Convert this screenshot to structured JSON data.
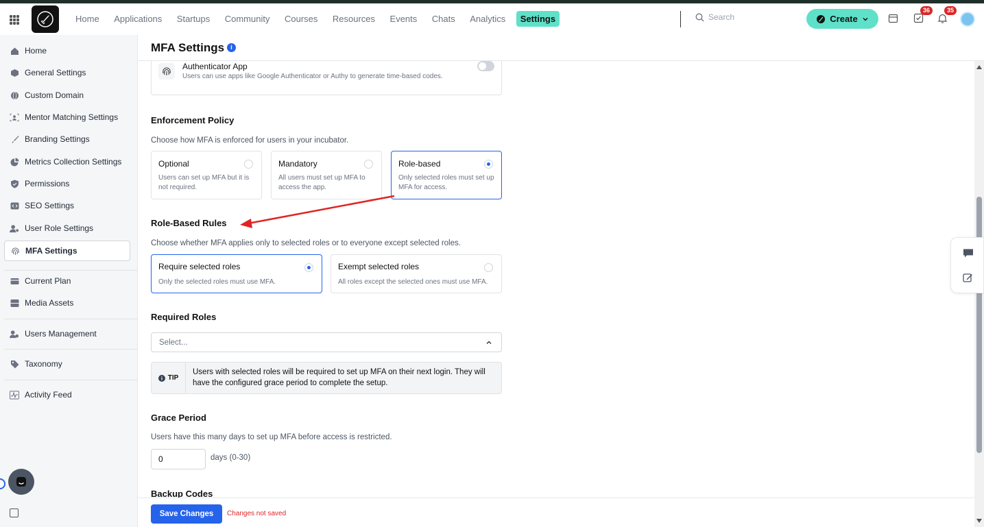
{
  "colors": {
    "accent": "#5ee1c8",
    "primary": "#2563eb",
    "danger": "#dc2626",
    "annotation_arrow": "#e02424"
  },
  "topnav": {
    "items": [
      "Home",
      "Applications",
      "Startups",
      "Community",
      "Courses",
      "Resources",
      "Events",
      "Chats",
      "Analytics",
      "Settings"
    ],
    "active": "Settings",
    "search_placeholder": "Search",
    "create_label": "Create",
    "tasks_badge": "36",
    "notifications_badge": "35"
  },
  "sidebar": {
    "items": [
      {
        "label": "Home",
        "icon": "home-icon"
      },
      {
        "label": "General Settings",
        "icon": "cube-icon"
      },
      {
        "label": "Custom Domain",
        "icon": "globe-icon"
      },
      {
        "label": "Mentor Matching Settings",
        "icon": "users-match-icon"
      },
      {
        "label": "Branding Settings",
        "icon": "brush-icon"
      },
      {
        "label": "Metrics Collection Settings",
        "icon": "pie-chart-icon"
      },
      {
        "label": "Permissions",
        "icon": "shield-icon"
      },
      {
        "label": "SEO Settings",
        "icon": "code-icon"
      },
      {
        "label": "User Role Settings",
        "icon": "user-gear-icon"
      },
      {
        "label": "MFA Settings",
        "icon": "fingerprint-icon"
      },
      {
        "label": "Current Plan",
        "icon": "card-icon"
      },
      {
        "label": "Media Assets",
        "icon": "media-icon"
      },
      {
        "label": "Users Management",
        "icon": "users-icon"
      },
      {
        "label": "Taxonomy",
        "icon": "tag-icon"
      },
      {
        "label": "Activity Feed",
        "icon": "activity-icon"
      }
    ],
    "active": "MFA Settings"
  },
  "page": {
    "title": "MFA Settings",
    "authenticator": {
      "title": "Authenticator App",
      "description": "Users can use apps like Google Authenticator or Authy to generate time-based codes.",
      "enabled": false
    },
    "enforcement": {
      "title": "Enforcement Policy",
      "description": "Choose how MFA is enforced for users in your incubator.",
      "options": [
        {
          "title": "Optional",
          "description": "Users can set up MFA but it is not required.",
          "selected": false
        },
        {
          "title": "Mandatory",
          "description": "All users must set up MFA to access the app.",
          "selected": false
        },
        {
          "title": "Role-based",
          "description": "Only selected roles must set up MFA for access.",
          "selected": true
        }
      ]
    },
    "role_rules": {
      "title": "Role-Based Rules",
      "description": "Choose whether MFA applies only to selected roles or to everyone except selected roles.",
      "options": [
        {
          "title": "Require selected roles",
          "description": "Only the selected roles must use MFA.",
          "selected": true
        },
        {
          "title": "Exempt selected roles",
          "description": "All roles except the selected ones must use MFA.",
          "selected": false
        }
      ]
    },
    "required_roles": {
      "title": "Required Roles",
      "placeholder": "Select..."
    },
    "tip": {
      "label": "TIP",
      "text": "Users with selected roles will be required to set up MFA on their next login. They will have the configured grace period to complete the setup."
    },
    "grace_period": {
      "title": "Grace Period",
      "description": "Users have this many days to set up MFA before access is restricted.",
      "value": "0",
      "unit_label": "days (0-30)"
    },
    "backup_codes": {
      "title": "Backup Codes"
    }
  },
  "footer": {
    "save_label": "Save Changes",
    "status": "Changes not saved"
  }
}
